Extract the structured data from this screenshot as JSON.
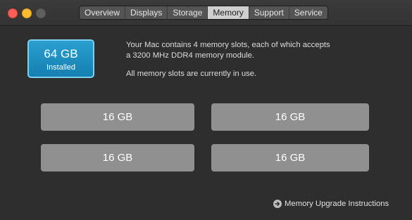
{
  "tabs": [
    {
      "label": "Overview",
      "active": false
    },
    {
      "label": "Displays",
      "active": false
    },
    {
      "label": "Storage",
      "active": false
    },
    {
      "label": "Memory",
      "active": true
    },
    {
      "label": "Support",
      "active": false
    },
    {
      "label": "Service",
      "active": false
    }
  ],
  "memory": {
    "total": "64 GB",
    "installed_label": "Installed",
    "description_line1": "Your Mac contains 4 memory slots, each of which accepts",
    "description_line2": "a 3200 MHz DDR4 memory module.",
    "status": "All memory slots are currently in use.",
    "slots": [
      "16 GB",
      "16 GB",
      "16 GB",
      "16 GB"
    ]
  },
  "upgrade_link": {
    "label": "Memory Upgrade Instructions",
    "icon": "arrow-circle-right-icon"
  },
  "colors": {
    "window_bg": "#2e2e2e",
    "installed_accent": "#1a8fc2",
    "slot_bg": "#909090",
    "close": "#ff5f57",
    "minimize": "#febc2e"
  }
}
